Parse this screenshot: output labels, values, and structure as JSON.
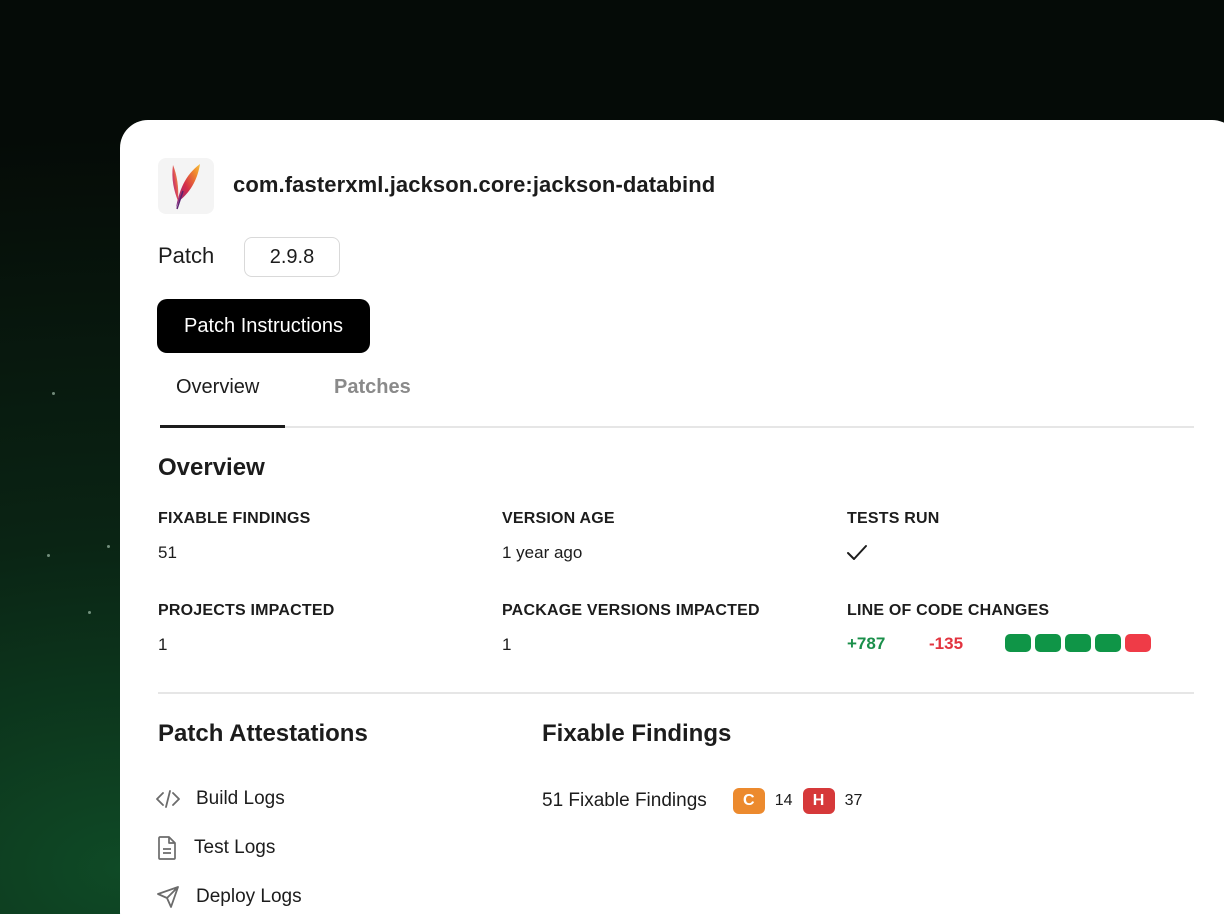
{
  "package": {
    "name": "com.fasterxml.jackson.core:jackson-databind",
    "logo_icon": "apache-feather-icon"
  },
  "patch": {
    "label": "Patch",
    "version": "2.9.8",
    "instructions_button": "Patch Instructions"
  },
  "tabs": [
    {
      "label": "Overview",
      "active": true
    },
    {
      "label": "Patches",
      "active": false
    }
  ],
  "overview": {
    "title": "Overview",
    "stats": {
      "fixable_findings": {
        "label": "FIXABLE FINDINGS",
        "value": "51"
      },
      "version_age": {
        "label": "VERSION AGE",
        "value": "1 year ago"
      },
      "tests_run": {
        "label": "TESTS RUN",
        "icon": "checkmark-icon"
      },
      "projects_impacted": {
        "label": "PROJECTS IMPACTED",
        "value": "1"
      },
      "package_versions_impacted": {
        "label": "PACKAGE VERSIONS IMPACTED",
        "value": "1"
      },
      "line_of_code_changes": {
        "label": "LINE OF CODE CHANGES",
        "additions": "+787",
        "deletions": "-135",
        "bar_blocks": [
          "added",
          "added",
          "added",
          "added",
          "removed"
        ]
      }
    }
  },
  "attestations": {
    "title": "Patch Attestations",
    "items": [
      {
        "label": "Build Logs",
        "icon": "code-icon"
      },
      {
        "label": "Test Logs",
        "icon": "document-icon"
      },
      {
        "label": "Deploy Logs",
        "icon": "send-icon"
      }
    ]
  },
  "findings": {
    "title": "Fixable Findings",
    "summary": "51 Fixable Findings",
    "severities": [
      {
        "letter": "C",
        "count": "14",
        "color": "#ec8a2e"
      },
      {
        "letter": "H",
        "count": "37",
        "color": "#d6393a"
      }
    ]
  },
  "colors": {
    "added": "#0f9547",
    "removed": "#ef3b47",
    "plus_text": "#1a8f4a",
    "minus_text": "#e2343f"
  }
}
